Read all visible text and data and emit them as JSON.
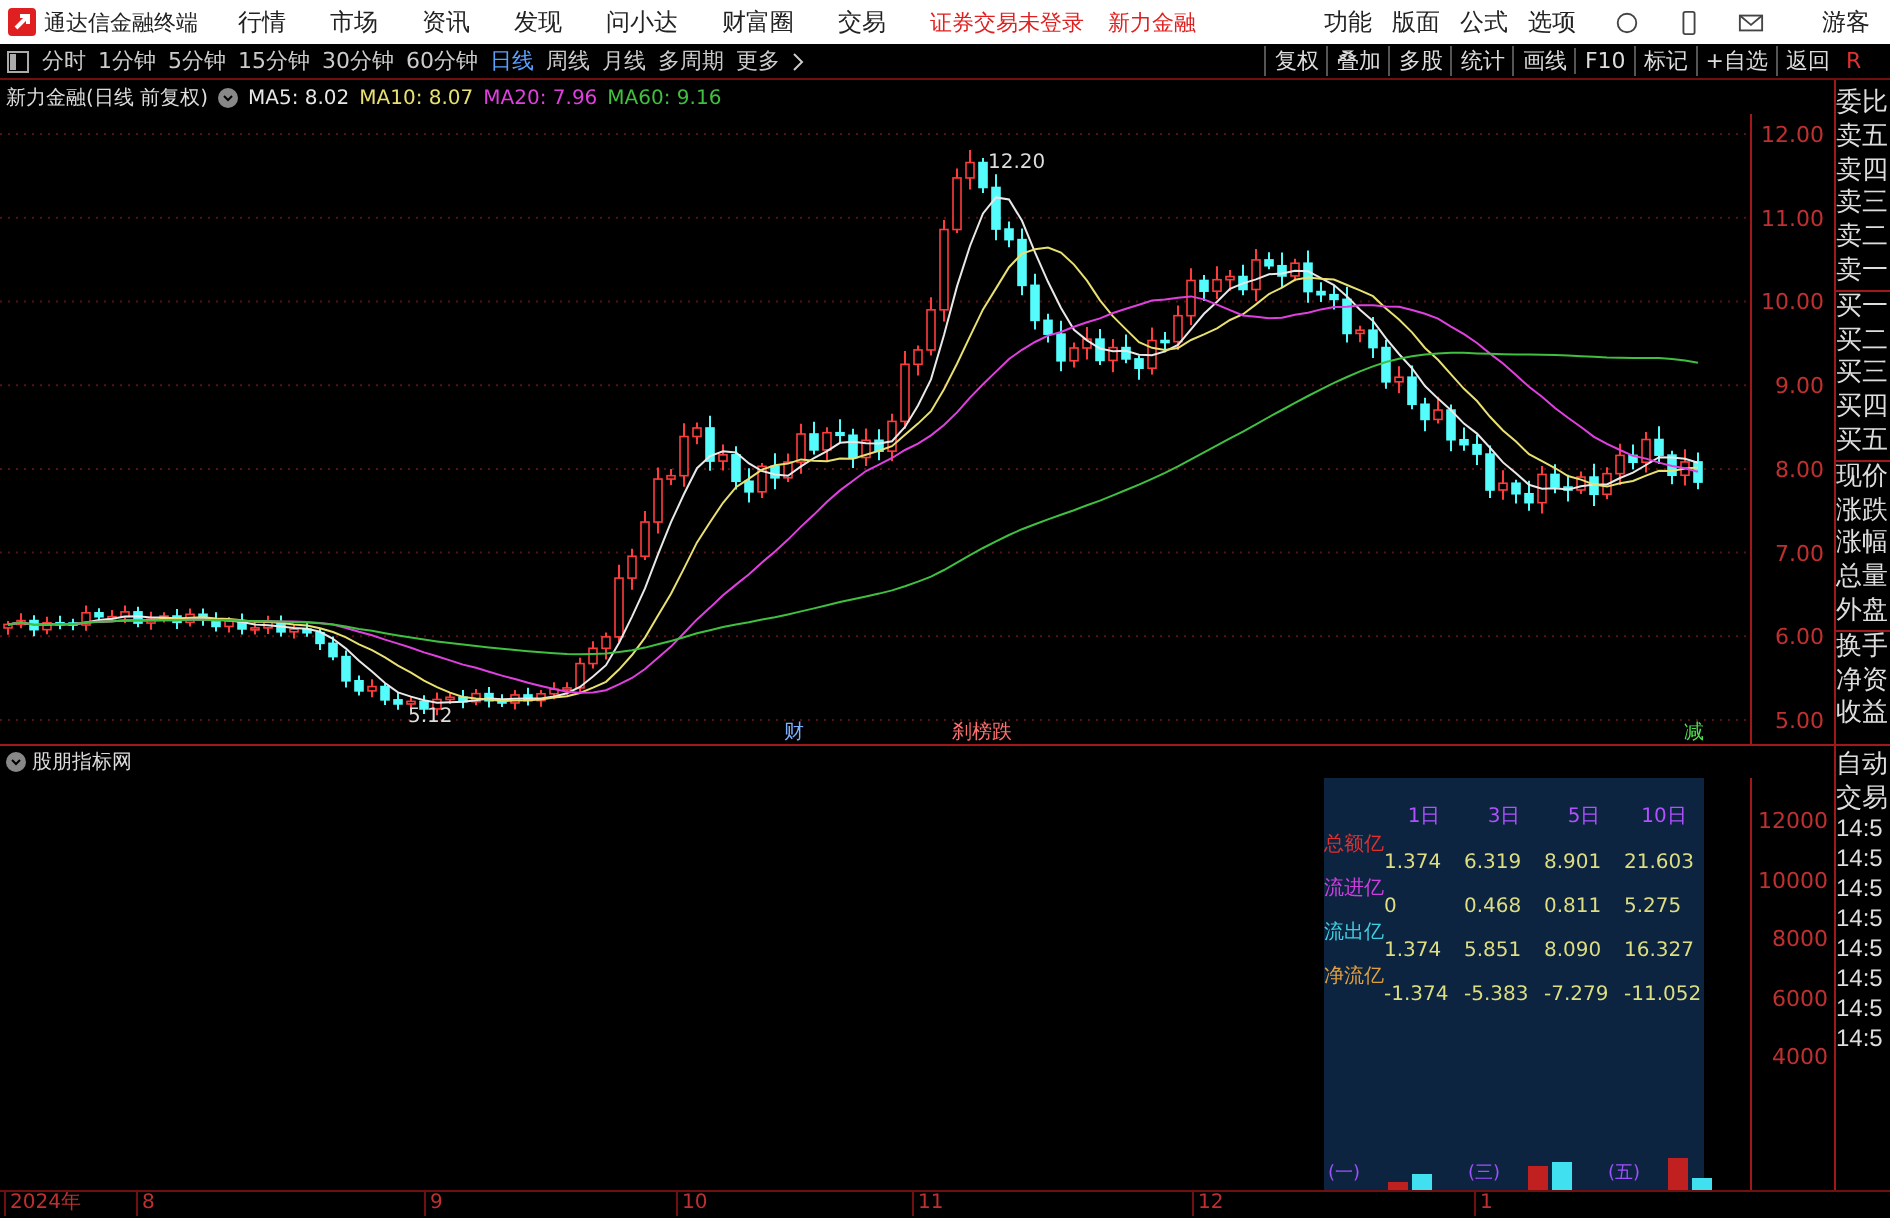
{
  "title_bar": {
    "app_name": "通达信金融终端",
    "menu": [
      "行情",
      "市场",
      "资讯",
      "发现",
      "问小达",
      "财富圈",
      "交易"
    ],
    "notices": [
      "证券交易未登录",
      "新力金融"
    ],
    "right_menu": [
      "功能",
      "版面",
      "公式",
      "选项"
    ],
    "user": "游客"
  },
  "period_tabs": [
    {
      "label": "分时",
      "selected": false
    },
    {
      "label": "1分钟",
      "selected": false
    },
    {
      "label": "5分钟",
      "selected": false
    },
    {
      "label": "15分钟",
      "selected": false
    },
    {
      "label": "30分钟",
      "selected": false
    },
    {
      "label": "60分钟",
      "selected": false
    },
    {
      "label": "日线",
      "selected": true
    },
    {
      "label": "周线",
      "selected": false
    },
    {
      "label": "月线",
      "selected": false
    },
    {
      "label": "多周期",
      "selected": false
    },
    {
      "label": "更多",
      "selected": false
    }
  ],
  "tools": [
    "复权",
    "叠加",
    "多股",
    "统计",
    "画线",
    "F10",
    "标记",
    "+自选",
    "返回"
  ],
  "corner_mark": "R",
  "chart_header": {
    "title": "新力金融(日线 前复权)",
    "ma": [
      {
        "label": "MA5: 8.02",
        "color": "#e8e8e8"
      },
      {
        "label": "MA10: 8.07",
        "color": "#e8e070"
      },
      {
        "label": "MA20: 7.96",
        "color": "#e040e0"
      },
      {
        "label": "MA60: 9.16",
        "color": "#40c040"
      }
    ]
  },
  "price_axis": [
    "12.00",
    "11.00",
    "10.00",
    "9.00",
    "8.00",
    "7.00",
    "6.00",
    "5.00"
  ],
  "price_labels": {
    "high": "12.20",
    "low": "5.12"
  },
  "event_marks": [
    {
      "text": "财",
      "color": "#7fb0ff"
    },
    {
      "text": "刹榜跌",
      "color": "#ff7070"
    },
    {
      "text": "减",
      "color": "#50e050"
    }
  ],
  "quote_labels": [
    "委比",
    "卖五",
    "卖四",
    "卖三",
    "卖二",
    "卖一",
    "买一",
    "买二",
    "买三",
    "买四",
    "买五",
    "现价",
    "涨跌",
    "涨幅",
    "总量",
    "外盘",
    "换手",
    "净资",
    "收益"
  ],
  "indicator": {
    "title": "股朋指标网",
    "columns": [
      "1日",
      "3日",
      "5日",
      "10日"
    ],
    "rows": [
      {
        "label": "总额亿",
        "color": "#e03030",
        "values": [
          "1.374",
          "6.319",
          "8.901",
          "21.603"
        ]
      },
      {
        "label": "流进亿",
        "color": "#d040e0",
        "values": [
          "0",
          "0.468",
          "0.811",
          "5.275"
        ]
      },
      {
        "label": "流出亿",
        "color": "#40d0e0",
        "values": [
          "1.374",
          "5.851",
          "8.090",
          "16.327"
        ]
      },
      {
        "label": "净流亿",
        "color": "#e0a040",
        "values": [
          "-1.374",
          "-5.383",
          "-7.279",
          "-11.052"
        ]
      }
    ],
    "axis": [
      "12000",
      "10000",
      "8000",
      "6000",
      "4000"
    ],
    "mini_bars": [
      "(一)",
      "(三)",
      "(五)"
    ]
  },
  "trade_panel": {
    "header": [
      "自动",
      "交易"
    ],
    "times": [
      "14:5",
      "14:5",
      "14:5",
      "14:5",
      "14:5",
      "14:5",
      "14:5",
      "14:5"
    ]
  },
  "date_axis": [
    "2024年",
    "8",
    "9",
    "10",
    "11",
    "12",
    "1"
  ]
}
